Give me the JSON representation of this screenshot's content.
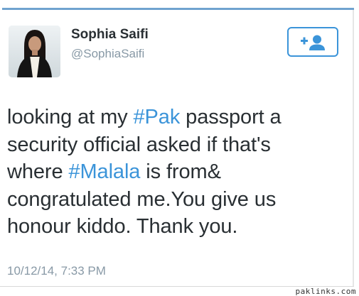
{
  "tweet": {
    "display_name": "Sophia Saifi",
    "handle": "@SophiaSaifi",
    "follow_button_icon": "follow-user-plus-icon",
    "lines": [
      [
        {
          "text": "looking at my "
        },
        {
          "text": "#Pak",
          "hashtag": true
        },
        {
          "text": " passport a"
        }
      ],
      [
        {
          "text": "security official asked if that's"
        }
      ],
      [
        {
          "text": "where "
        },
        {
          "text": "#Malala",
          "hashtag": true
        },
        {
          "text": " is from&"
        }
      ],
      [
        {
          "text": "congratulated me.You give us"
        }
      ],
      [
        {
          "text": "honour kiddo. Thank you."
        }
      ]
    ],
    "timestamp": "10/12/14, 7:33 PM"
  },
  "watermark": "paklinks.com",
  "colors": {
    "link_blue": "#3b94d9",
    "text_dark": "#292f33",
    "text_gray": "#8899a6",
    "top_rule": "#6fa3cf"
  }
}
